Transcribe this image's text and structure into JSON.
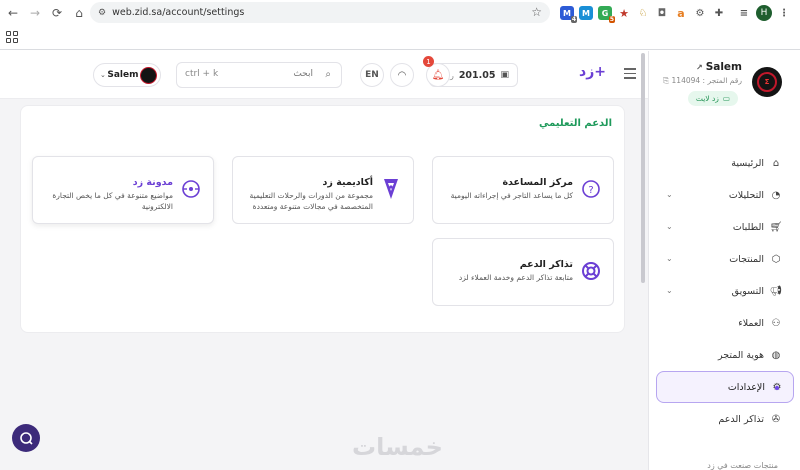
{
  "browser": {
    "url": "web.zid.sa/account/settings",
    "profile_initial": "H",
    "ext_badges": [
      "4",
      "5"
    ]
  },
  "header": {
    "balance_amount": "201.05",
    "balance_currency": "ر.س",
    "notification_count": "1",
    "language": "EN",
    "search_placeholder": "ابحث",
    "search_shortcut": "ctrl + k",
    "user_name": "Salem"
  },
  "sidebar": {
    "store_name": "Salem",
    "store_id": "رقم المتجر : 114094",
    "live_label": "زد لايت",
    "items": [
      {
        "label": "الرئيسية",
        "icon": "home-icon"
      },
      {
        "label": "التحليلات",
        "icon": "chart-icon",
        "expandable": true
      },
      {
        "label": "الطلبات",
        "icon": "cart-icon",
        "expandable": true
      },
      {
        "label": "المنتجات",
        "icon": "box-icon",
        "expandable": true
      },
      {
        "label": "التسويق",
        "icon": "megaphone-icon",
        "expandable": true
      },
      {
        "label": "العملاء",
        "icon": "users-icon"
      },
      {
        "label": "هوية المتجر",
        "icon": "palette-icon"
      },
      {
        "label": "الإعدادات",
        "icon": "gear-icon",
        "active": true
      },
      {
        "label": "تذاكر الدعم",
        "icon": "lifebuoy-icon"
      }
    ],
    "footer_text": "منتجات صنعت في زد"
  },
  "main": {
    "section_title": "الدعم التعليمي",
    "tiles": [
      {
        "title": "مركز المساعدة",
        "desc": "كل ما يساعد التاجر في إجراءاته اليومية",
        "icon": "help-circle-icon"
      },
      {
        "title": "أكاديمية زد",
        "desc": "مجموعة من الدورات والرحلات التعليمية المتخصصة في مجالات متنوعة ومتعددة",
        "icon": "academy-icon"
      },
      {
        "title": "مدونة زد",
        "desc": "مواضيع متنوعة في كل ما يخص التجارة الالكترونية",
        "icon": "blog-icon"
      },
      {
        "title": "تذاكر الدعم",
        "desc": "متابعة تذاكر الدعم وخدمة العملاء لزد",
        "icon": "lifebuoy-icon"
      }
    ]
  },
  "watermark": "خمسات",
  "colors": {
    "brand": "#6b3fd4",
    "accent_green": "#1f9a5b",
    "notification": "#e4483a"
  }
}
